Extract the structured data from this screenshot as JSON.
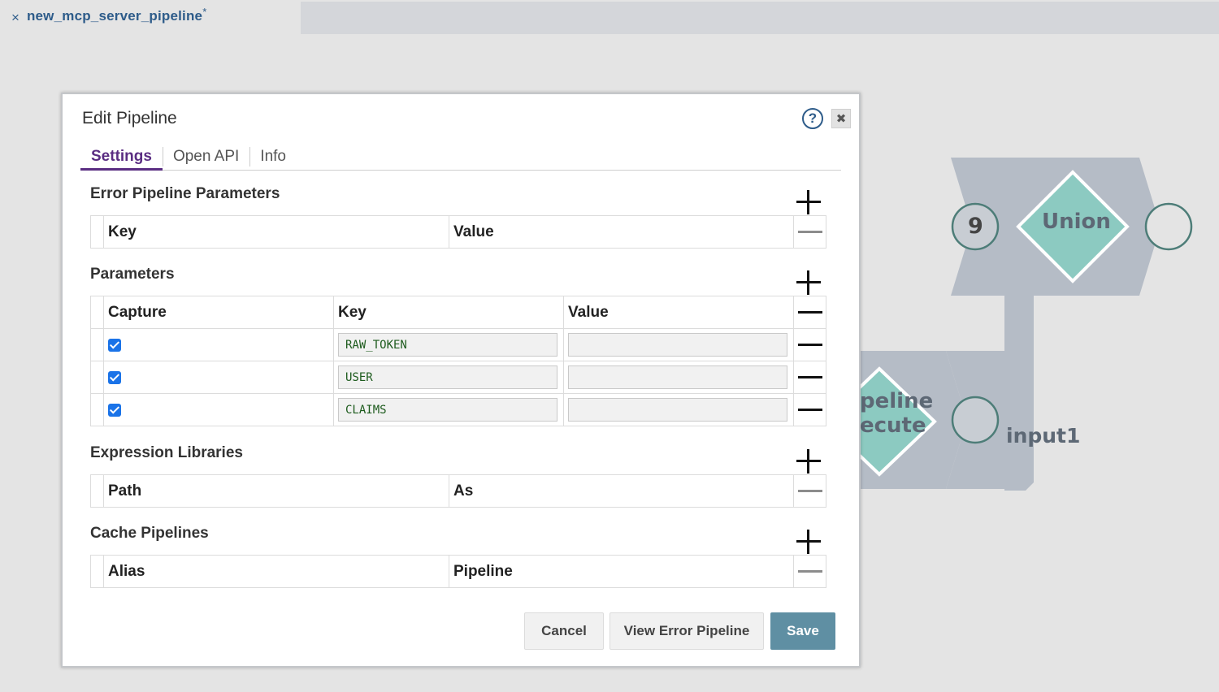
{
  "tab": {
    "close_glyph": "×",
    "title": "new_mcp_server_pipeline",
    "modified_marker": "*"
  },
  "canvas": {
    "union_label": "Union",
    "union_badge": "9",
    "pipeline_label_line1": "peline",
    "pipeline_label_line2": "ecute",
    "input_label": "input1"
  },
  "modal": {
    "title": "Edit Pipeline",
    "help_glyph": "?",
    "close_glyph": "✖",
    "tabs": [
      {
        "label": "Settings",
        "active": true
      },
      {
        "label": "Open API",
        "active": false
      },
      {
        "label": "Info",
        "active": false
      }
    ],
    "error_params": {
      "title": "Error Pipeline Parameters",
      "col_key": "Key",
      "col_value": "Value"
    },
    "params": {
      "title": "Parameters",
      "col_capture": "Capture",
      "col_key": "Key",
      "col_value": "Value",
      "rows": [
        {
          "capture": true,
          "key": "RAW_TOKEN",
          "value": ""
        },
        {
          "capture": true,
          "key": "USER",
          "value": ""
        },
        {
          "capture": true,
          "key": "CLAIMS",
          "value": ""
        }
      ]
    },
    "expr_libs": {
      "title": "Expression Libraries",
      "col_path": "Path",
      "col_as": "As"
    },
    "cache": {
      "title": "Cache Pipelines",
      "col_alias": "Alias",
      "col_pipeline": "Pipeline"
    },
    "buttons": {
      "cancel": "Cancel",
      "view_error": "View Error Pipeline",
      "save": "Save"
    }
  },
  "colors": {
    "accent_tab": "#5a2d82",
    "link": "#2e5c8a",
    "save_button": "#5f8fa3",
    "snap_gray": "#b5bcc6",
    "snap_green": "#8ccac1"
  }
}
